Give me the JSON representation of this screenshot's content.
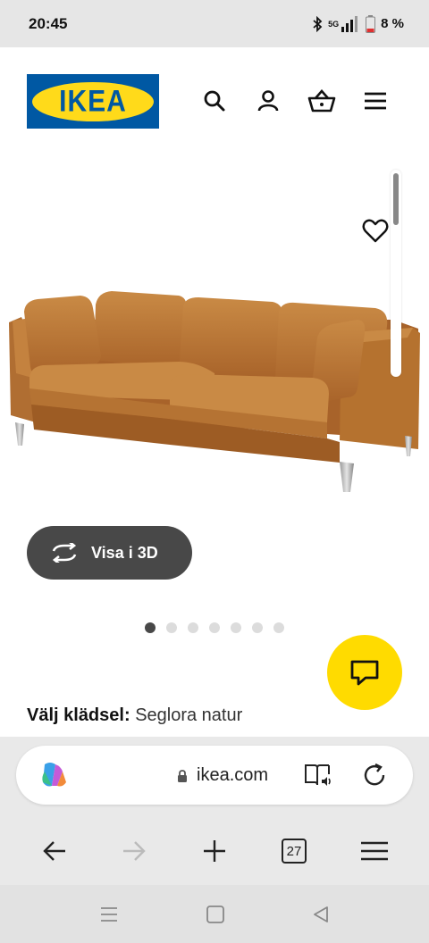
{
  "status_bar": {
    "time": "20:45",
    "network": "5G",
    "battery": "8 %",
    "icons": [
      "bluetooth-icon",
      "signal-icon",
      "battery-icon"
    ]
  },
  "header": {
    "logo_text": "IKEA",
    "icons": [
      "search-icon",
      "account-icon",
      "basket-icon",
      "menu-icon"
    ]
  },
  "product": {
    "image_alt": "sofa",
    "view_3d_label": "Visa i 3D",
    "gallery_total": 7,
    "gallery_active": 1,
    "upholstery_label": "Välj klädsel:",
    "upholstery_value": "Seglora natur"
  },
  "browser": {
    "url": "ikea.com",
    "tab_count": "27"
  },
  "colors": {
    "ikea_blue": "#0058a3",
    "ikea_yellow": "#ffda1a",
    "leather": "#c07a36",
    "button_dark": "#484848"
  }
}
